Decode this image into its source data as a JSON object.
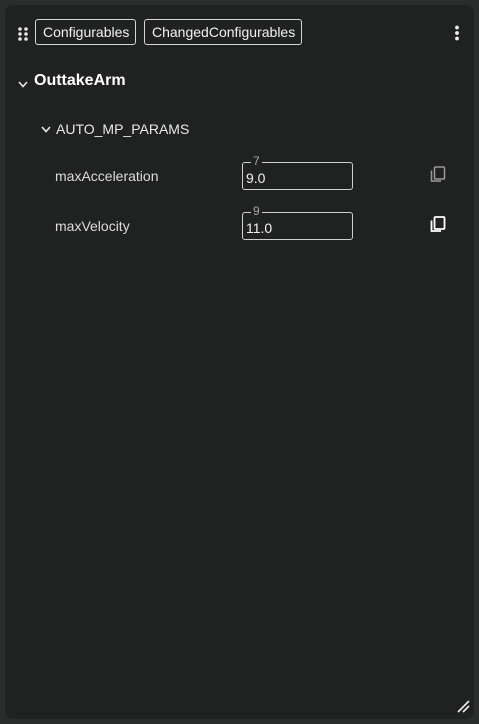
{
  "toolbar": {
    "configurables_label": "Configurables",
    "changed_label": "ChangedConfigurables"
  },
  "group": {
    "title": "OuttakeArm",
    "expanded": true,
    "subgroup": {
      "title": "AUTO_MP_PARAMS",
      "expanded": true,
      "params": [
        {
          "label": "maxAcceleration",
          "legend": "7",
          "value": "9.0",
          "copy_icon": "copy-outline-icon"
        },
        {
          "label": "maxVelocity",
          "legend": "9",
          "value": "11.0",
          "copy_icon": "copy-filled-icon"
        }
      ]
    }
  },
  "colors": {
    "panel_bg": "#202121",
    "page_bg": "#2b2c2c",
    "text": "#e6e6e6",
    "border": "#d6d6d6"
  }
}
